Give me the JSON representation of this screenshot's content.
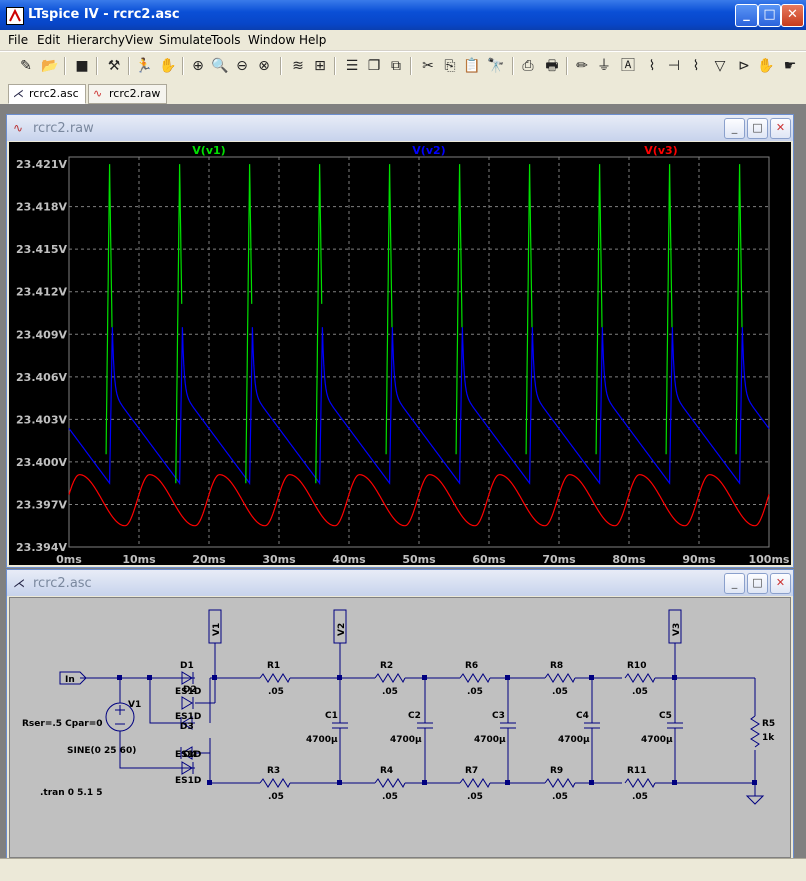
{
  "app": {
    "title": "LTspice IV - rcrc2.asc"
  },
  "window_buttons": {
    "minimize": "_",
    "maximize": "□",
    "close": "✕"
  },
  "menu": [
    "File",
    "Edit",
    "Hierarchy",
    "View",
    "Simulate",
    "Tools",
    "Window",
    "Help"
  ],
  "tabs": [
    {
      "label": "rcrc2.asc",
      "icon": "schematic-icon"
    },
    {
      "label": "rcrc2.raw",
      "icon": "waveform-icon"
    }
  ],
  "waveform_window": {
    "title": "rcrc2.raw"
  },
  "schematic_window": {
    "title": "rcrc2.asc"
  },
  "colors": {
    "v1": "#00e000",
    "v2": "#0000ff",
    "v3": "#ff0000",
    "plot_bg": "#000000",
    "grid": "#808080",
    "axis_text": "#c0c0c0"
  },
  "chart_data": {
    "type": "line",
    "title": "",
    "xlabel": "",
    "ylabel": "",
    "x_ticks": [
      "0ms",
      "10ms",
      "20ms",
      "30ms",
      "40ms",
      "50ms",
      "60ms",
      "70ms",
      "80ms",
      "90ms",
      "100ms"
    ],
    "y_ticks": [
      "23.394V",
      "23.397V",
      "23.400V",
      "23.403V",
      "23.406V",
      "23.409V",
      "23.412V",
      "23.415V",
      "23.418V",
      "23.421V"
    ],
    "xlim": [
      0,
      100
    ],
    "ylim": [
      23.394,
      23.4215
    ],
    "grid": true,
    "legend": "top",
    "series": [
      {
        "name": "V(v1)",
        "color": "#00e000",
        "period_ms": 10,
        "first_spike_ms": 5.8,
        "baseline": 23.3985,
        "peak": 23.421
      },
      {
        "name": "V(v2)",
        "color": "#0000ff",
        "period_ms": 10,
        "first_spike_ms": 5.8,
        "baseline": 23.3985,
        "peak": 23.4095
      },
      {
        "name": "V(v3)",
        "color": "#ff0000",
        "period_ms": 10,
        "min": 23.3955,
        "max": 23.3991
      }
    ]
  },
  "schematic": {
    "labels": {
      "in": "In",
      "v1": "V1",
      "v2": "V2",
      "v3": "V3",
      "d1": "D1",
      "d2_over": "ES1D",
      "d2": "D2",
      "d3": "D3",
      "d4": "D4",
      "es1": "ES1D",
      "es2": "ES1D",
      "es3": "ES1D",
      "es4": "ES1D",
      "rser": "Rser=.5 Cpar=0",
      "vsrc": "V1",
      "sine": "SINE(0 25 60)",
      "tran": ".tran 0 5.1 5"
    },
    "resistors": [
      {
        "name": "R1",
        "value": ".05"
      },
      {
        "name": "R2",
        "value": ".05"
      },
      {
        "name": "R6",
        "value": ".05"
      },
      {
        "name": "R8",
        "value": ".05"
      },
      {
        "name": "R10",
        "value": ".05"
      },
      {
        "name": "R3",
        "value": ".05"
      },
      {
        "name": "R4",
        "value": ".05"
      },
      {
        "name": "R7",
        "value": ".05"
      },
      {
        "name": "R9",
        "value": ".05"
      },
      {
        "name": "R11",
        "value": ".05"
      },
      {
        "name": "R5",
        "value": "1k"
      }
    ],
    "capacitors": [
      {
        "name": "C1",
        "value": "4700µ"
      },
      {
        "name": "C2",
        "value": "4700µ"
      },
      {
        "name": "C3",
        "value": "4700µ"
      },
      {
        "name": "C4",
        "value": "4700µ"
      },
      {
        "name": "C5",
        "value": "4700µ"
      }
    ]
  }
}
